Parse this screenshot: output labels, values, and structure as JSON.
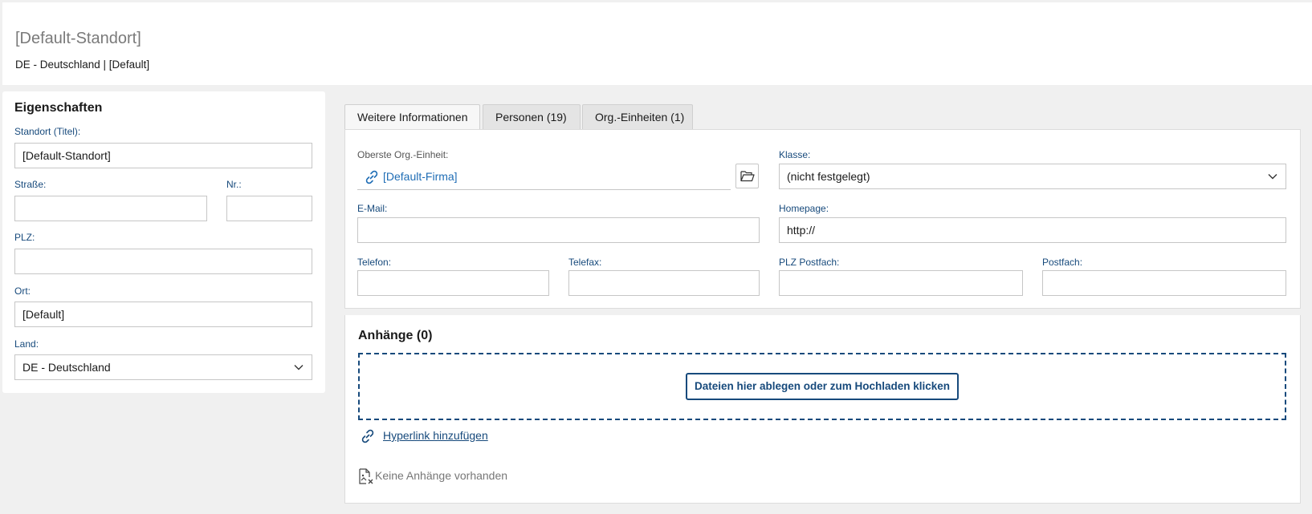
{
  "header": {
    "title": "[Default-Standort]",
    "subtitle": "DE - Deutschland | [Default]"
  },
  "properties": {
    "title": "Eigenschaften",
    "standort_label": "Standort (Titel):",
    "standort_value": "[Default-Standort]",
    "strasse_label": "Straße:",
    "strasse_value": "",
    "nr_label": "Nr.:",
    "nr_value": "",
    "plz_label": "PLZ:",
    "plz_value": "",
    "ort_label": "Ort:",
    "ort_value": "[Default]",
    "land_label": "Land:",
    "land_value": "DE - Deutschland"
  },
  "tabs": [
    {
      "label": "Weitere Informationen",
      "active": true
    },
    {
      "label": "Personen (19)",
      "active": false
    },
    {
      "label": "Org.-Einheiten (1)",
      "active": false
    }
  ],
  "info": {
    "org_label": "Oberste Org.-Einheit:",
    "org_value": "[Default-Firma]",
    "klasse_label": "Klasse:",
    "klasse_value": "(nicht festgelegt)",
    "email_label": "E-Mail:",
    "email_value": "",
    "homepage_label": "Homepage:",
    "homepage_value": "http://",
    "telefon_label": "Telefon:",
    "telefon_value": "",
    "telefax_label": "Telefax:",
    "telefax_value": "",
    "plz_postfach_label": "PLZ Postfach:",
    "plz_postfach_value": "",
    "postfach_label": "Postfach:",
    "postfach_value": ""
  },
  "attachments": {
    "title": "Anhänge (0)",
    "upload_label": "Dateien hier ablegen oder zum Hochladen klicken",
    "hyperlink_label": "Hyperlink hinzufügen",
    "empty_label": "Keine Anhänge vorhanden"
  },
  "colors": {
    "accent": "#174a7c",
    "link": "#1f6db5",
    "background": "#f0f0f0"
  },
  "icons": [
    "link-icon",
    "folder-open-icon",
    "chevron-down-icon",
    "file-x-icon"
  ]
}
